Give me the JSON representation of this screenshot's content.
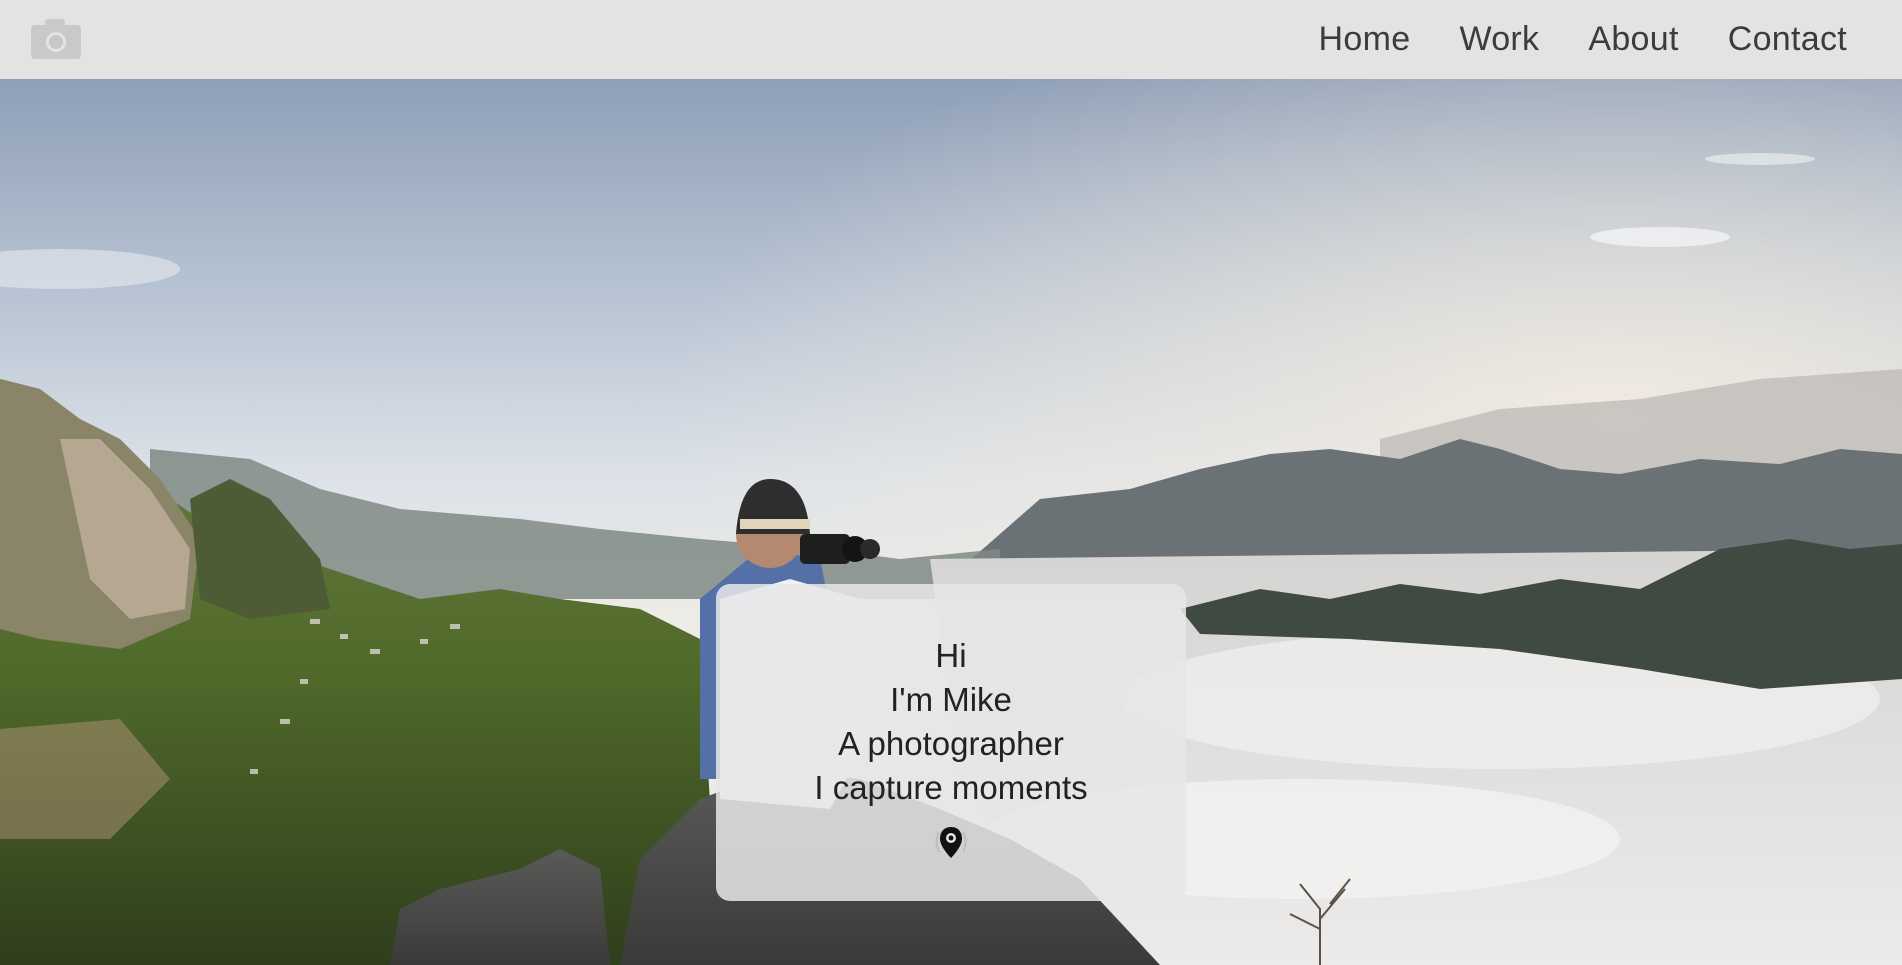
{
  "nav": {
    "logo_icon": "camera-icon",
    "links": [
      "Home",
      "Work",
      "About",
      "Contact"
    ]
  },
  "hero": {
    "image": "photographer on mountain peak above clouds",
    "card": {
      "lines": [
        "Hi",
        "I'm Mike",
        "A photographer",
        "I capture moments"
      ],
      "scroll_icon": "location-pin-icon"
    }
  },
  "colors": {
    "navbar": "#e3e3e3",
    "nav_text": "#3c3c3c",
    "card_bg": "#e6e6e8",
    "card_text": "#222222"
  }
}
